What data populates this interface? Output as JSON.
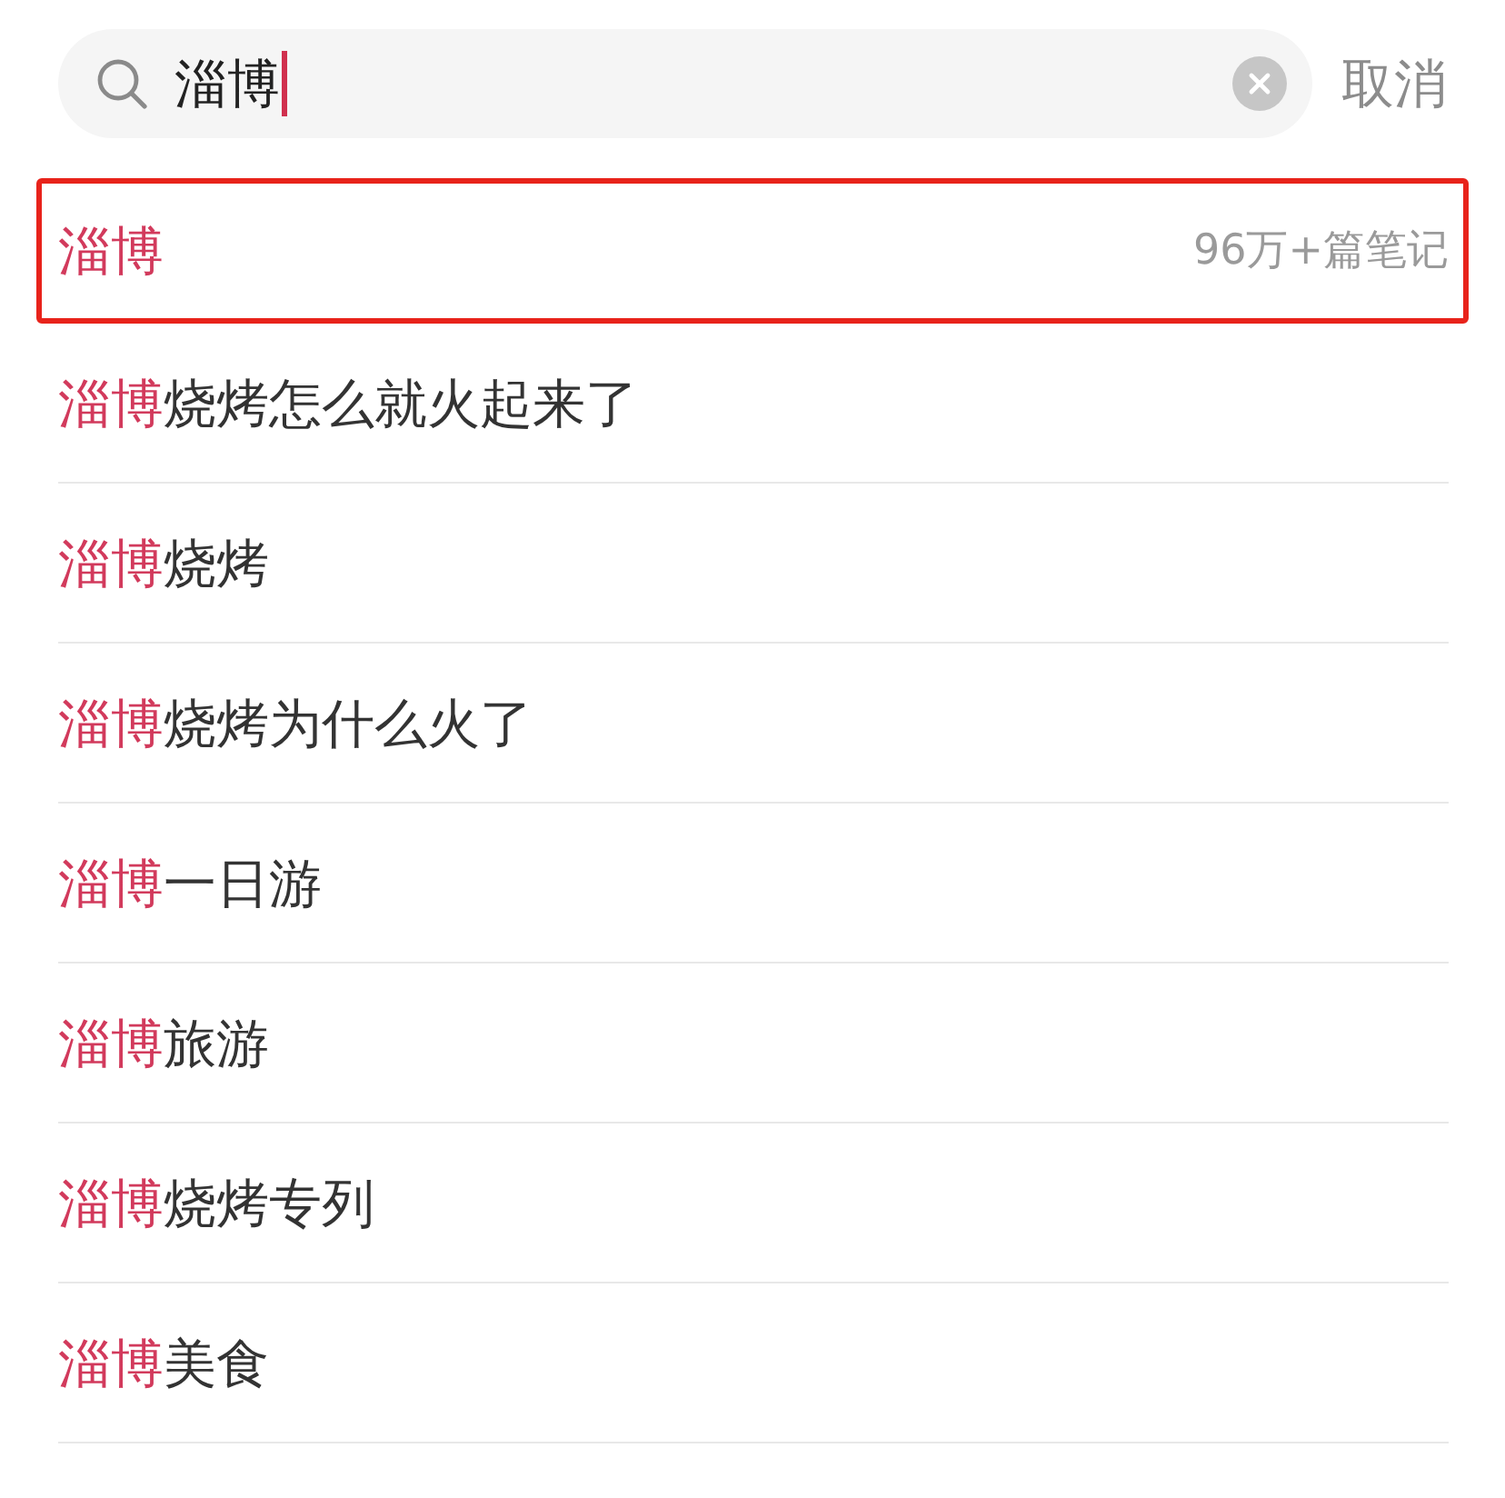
{
  "search": {
    "query": "淄博",
    "cancel": "取消"
  },
  "top_result": {
    "title": "淄博",
    "note_count": "96万+篇笔记",
    "highlighted": true
  },
  "suggestions": [
    {
      "match": "淄博",
      "rest": "烧烤怎么就火起来了"
    },
    {
      "match": "淄博",
      "rest": "烧烤"
    },
    {
      "match": "淄博",
      "rest": "烧烤为什么火了"
    },
    {
      "match": "淄博",
      "rest": "一日游"
    },
    {
      "match": "淄博",
      "rest": "旅游"
    },
    {
      "match": "淄博",
      "rest": "烧烤专列"
    },
    {
      "match": "淄博",
      "rest": "美食"
    }
  ]
}
